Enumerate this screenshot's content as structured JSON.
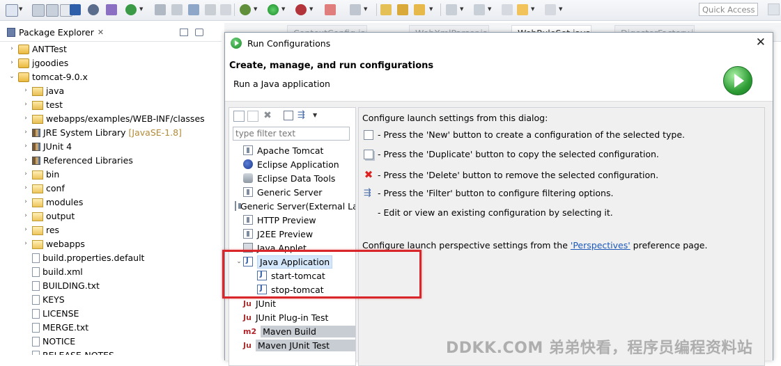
{
  "toolbar": {
    "quick_access_placeholder": "Quick Access"
  },
  "package_explorer": {
    "tab_label": "Package Explorer",
    "tree": [
      {
        "label": "ANTTest",
        "icon": "project-icon",
        "twisty": "›",
        "indent": 0
      },
      {
        "label": "jgoodies",
        "icon": "project-icon",
        "twisty": "›",
        "indent": 0
      },
      {
        "label": "tomcat-9.0.x",
        "icon": "project-icon",
        "twisty": "⌄",
        "indent": 0
      },
      {
        "label": "java",
        "icon": "source-folder-icon",
        "twisty": "›",
        "indent": 1
      },
      {
        "label": "test",
        "icon": "source-folder-icon",
        "twisty": "›",
        "indent": 1
      },
      {
        "label": "webapps/examples/WEB-INF/classes",
        "icon": "source-folder-icon",
        "twisty": "›",
        "indent": 1
      },
      {
        "label": "JRE System Library",
        "decor": "[JavaSE-1.8]",
        "icon": "library-icon",
        "twisty": "›",
        "indent": 1
      },
      {
        "label": "JUnit 4",
        "icon": "library-icon",
        "twisty": "›",
        "indent": 1
      },
      {
        "label": "Referenced Libraries",
        "icon": "library-icon",
        "twisty": "›",
        "indent": 1
      },
      {
        "label": "bin",
        "icon": "folder-icon",
        "twisty": "›",
        "indent": 1
      },
      {
        "label": "conf",
        "icon": "folder-icon",
        "twisty": "›",
        "indent": 1
      },
      {
        "label": "modules",
        "icon": "folder-icon",
        "twisty": "›",
        "indent": 1
      },
      {
        "label": "output",
        "icon": "folder-icon",
        "twisty": "›",
        "indent": 1
      },
      {
        "label": "res",
        "icon": "folder-icon",
        "twisty": "›",
        "indent": 1
      },
      {
        "label": "webapps",
        "icon": "folder-icon",
        "twisty": "›",
        "indent": 1
      },
      {
        "label": "build.properties.default",
        "icon": "file-icon",
        "twisty": "",
        "indent": 1
      },
      {
        "label": "build.xml",
        "icon": "ant-file-icon",
        "twisty": "",
        "indent": 1
      },
      {
        "label": "BUILDING.txt",
        "icon": "file-icon",
        "twisty": "",
        "indent": 1
      },
      {
        "label": "KEYS",
        "icon": "file-icon",
        "twisty": "",
        "indent": 1
      },
      {
        "label": "LICENSE",
        "icon": "file-icon",
        "twisty": "",
        "indent": 1
      },
      {
        "label": "MERGE.txt",
        "icon": "file-icon",
        "twisty": "",
        "indent": 1
      },
      {
        "label": "NOTICE",
        "icon": "file-icon",
        "twisty": "",
        "indent": 1
      },
      {
        "label": "RELEASE-NOTES",
        "icon": "file-icon",
        "twisty": "",
        "indent": 1
      }
    ]
  },
  "editor_tabs": [
    "ContextConfig.java",
    "WebXmlParser.java",
    "WebRuleSet.java",
    "DigesterFactory.java"
  ],
  "dialog": {
    "title": "Run Configurations",
    "heading": "Create, manage, and run configurations",
    "subheading": "Run a Java application",
    "filter_placeholder": "type filter text",
    "config_types": [
      {
        "label": "Apache Tomcat",
        "icon": "launch-icon"
      },
      {
        "label": "Eclipse Application",
        "icon": "eclipse-icon"
      },
      {
        "label": "Eclipse Data Tools",
        "icon": "database-icon"
      },
      {
        "label": "Generic Server",
        "icon": "launch-icon"
      },
      {
        "label": "Generic Server(External Launch)",
        "icon": "launch-icon"
      },
      {
        "label": "HTTP Preview",
        "icon": "launch-icon"
      },
      {
        "label": "J2EE Preview",
        "icon": "launch-icon"
      },
      {
        "label": "Java Applet",
        "icon": "applet-icon"
      },
      {
        "label": "Java Application",
        "icon": "java-app-icon",
        "expanded": true,
        "selected": true
      },
      {
        "label": "start-tomcat",
        "icon": "java-app-icon",
        "child": true
      },
      {
        "label": "stop-tomcat",
        "icon": "java-app-icon",
        "child": true
      },
      {
        "label": "JUnit",
        "icon": "junit-icon"
      },
      {
        "label": "JUnit Plug-in Test",
        "icon": "junit-icon"
      },
      {
        "label": "Maven Build",
        "icon": "maven-icon",
        "dim": true
      },
      {
        "label": "Maven JUnit Test",
        "icon": "junit-icon",
        "dim": true
      }
    ],
    "info": {
      "intro": "Configure launch settings from this dialog:",
      "lines": [
        {
          "icon": "new-config-icon",
          "text": "- Press the 'New' button to create a configuration of the selected type."
        },
        {
          "icon": "duplicate-icon",
          "text": "- Press the 'Duplicate' button to copy the selected configuration."
        },
        {
          "icon": "delete-icon",
          "text": "- Press the 'Delete' button to remove the selected configuration."
        },
        {
          "icon": "filter-icon",
          "text": "- Press the 'Filter' button to configure filtering options."
        },
        {
          "icon": "",
          "text": "- Edit or view an existing configuration by selecting it."
        }
      ],
      "perspective_prefix": "Configure launch perspective settings from the ",
      "perspective_link": "'Perspectives'",
      "perspective_suffix": " preference page."
    }
  },
  "watermark": "DDKK.COM 弟弟快看，程序员编程资料站",
  "colors": {
    "highlight": "#d8262a",
    "selection": "#d5e7fb",
    "link": "#1c58b8"
  }
}
